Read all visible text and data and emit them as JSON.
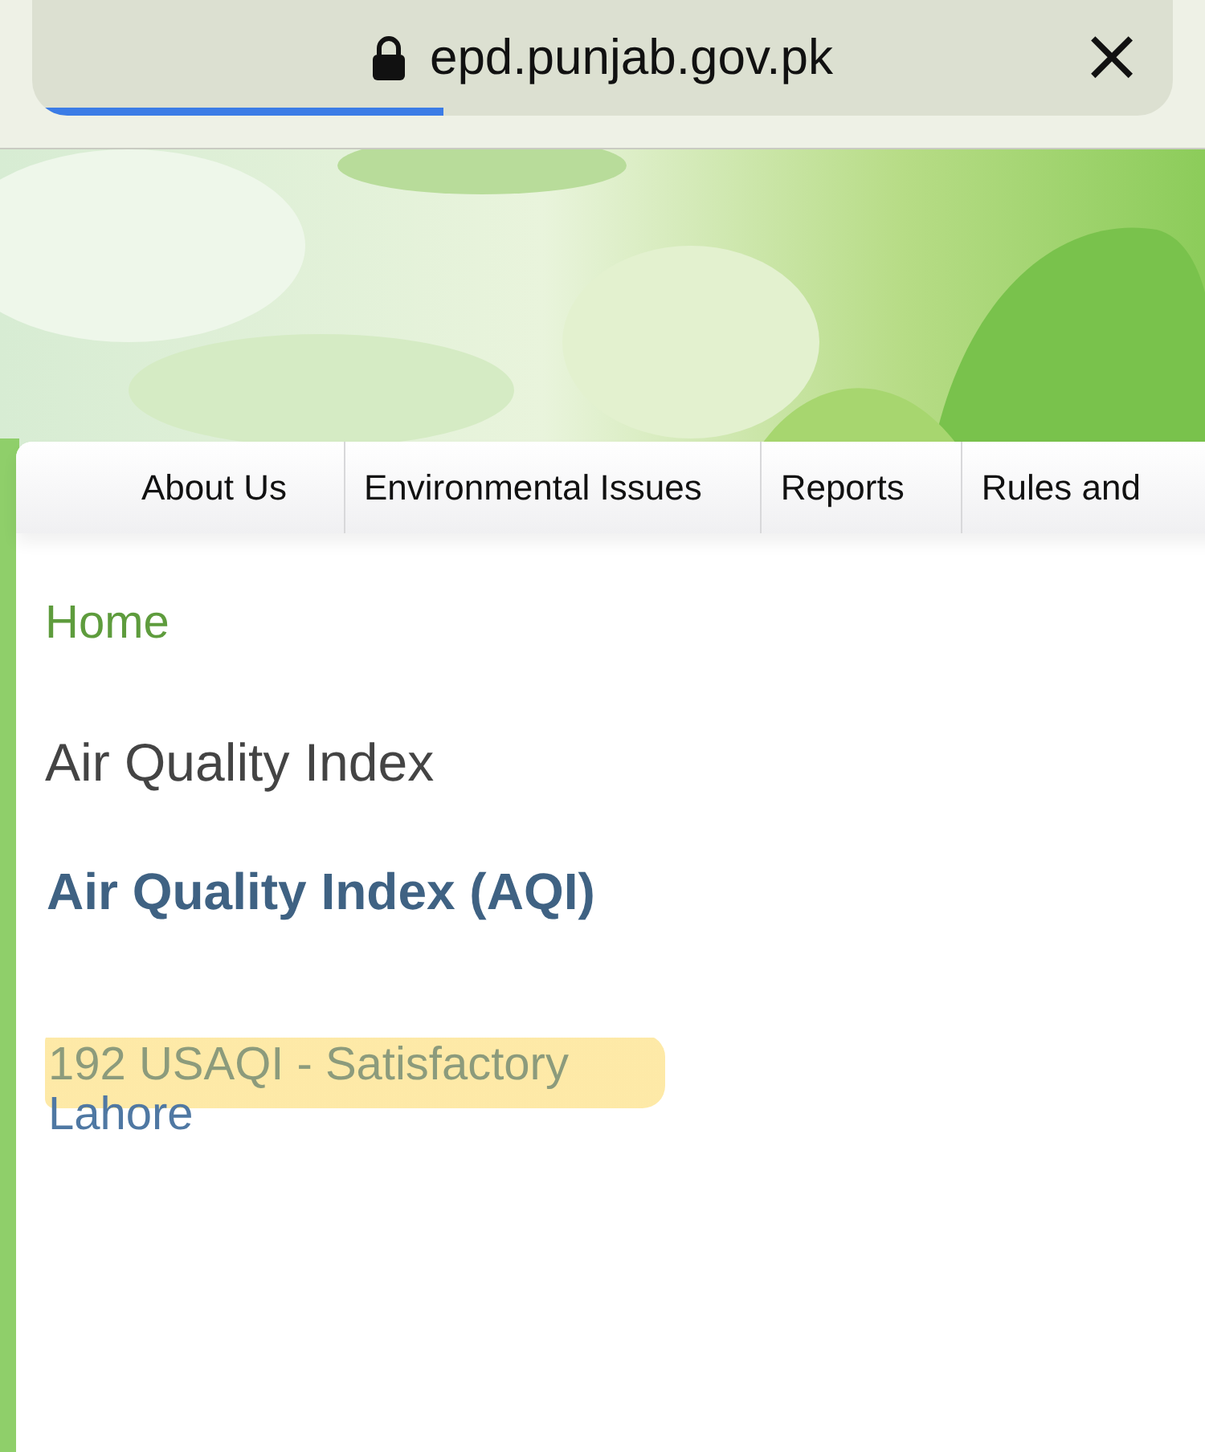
{
  "browser": {
    "url": "epd.punjab.gov.pk",
    "close": "×",
    "loading": {
      "level": 0.36
    }
  },
  "nav": [
    {
      "label": "About Us"
    },
    {
      "label": "Environmental Issues"
    },
    {
      "label": "Reports"
    },
    {
      "label": "Rules and"
    }
  ],
  "breadcrumb": "Home",
  "page_title": "Air Quality Index",
  "heading": "Air Quality Index (AQI)",
  "reading": {
    "text": "192 USAQI - Satisfactory",
    "highlighted": true
  },
  "city": "Lahore"
}
